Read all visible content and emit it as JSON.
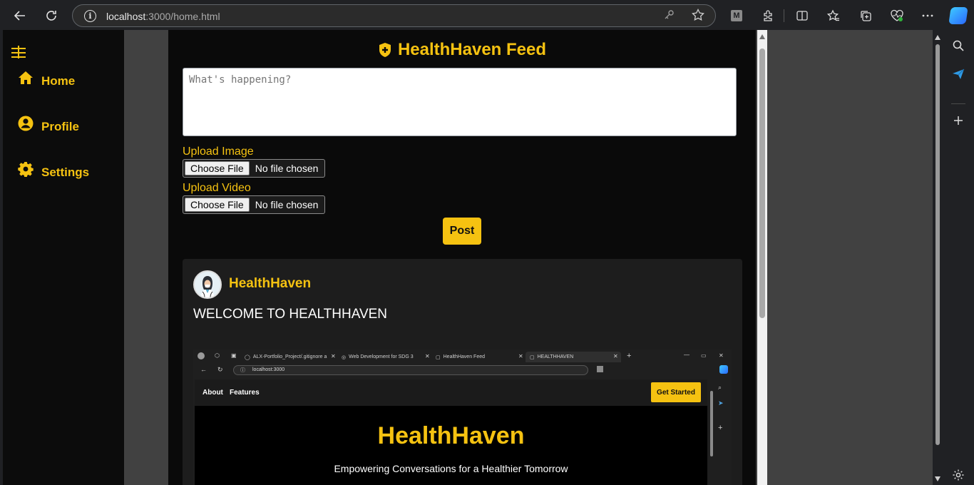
{
  "browser": {
    "url_host": "localhost",
    "url_rest": ":3000/home.html"
  },
  "sidebar": {
    "items": [
      {
        "label": "Home",
        "icon": "home-icon"
      },
      {
        "label": "Profile",
        "icon": "user-circle-icon"
      },
      {
        "label": "Settings",
        "icon": "gear-icon"
      }
    ]
  },
  "feed": {
    "title": "HealthHaven Feed",
    "placeholder": "What's happening?",
    "upload_image_label": "Upload Image",
    "upload_video_label": "Upload Video",
    "choose_file": "Choose File",
    "no_file": "No file chosen",
    "post_button": "Post"
  },
  "post": {
    "author": "HealthHaven",
    "text": "WELCOME TO HEALTHHAVEN",
    "screenshot": {
      "tabs": [
        "ALX-Portfolio_Project/.gitignore a",
        "Web Development for SDG 3",
        "HealthHaven Feed",
        "HEALTHHAVEN"
      ],
      "url": "localhost:3000",
      "nav_links": [
        "About",
        "Features"
      ],
      "cta": "Get Started",
      "hero": "HealthHaven",
      "tagline": "Empowering Conversations for a Healthier Tomorrow"
    }
  },
  "colors": {
    "accent": "#f5c211",
    "sidebar_bg": "#0c0c0c",
    "main_bg": "#0a0a0a",
    "card_bg": "#1d1d1d"
  }
}
